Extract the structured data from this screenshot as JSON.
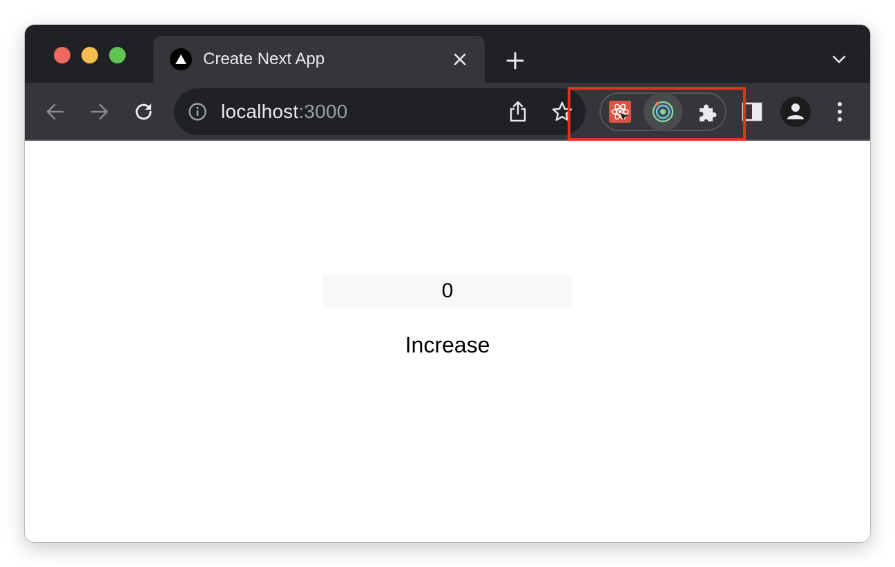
{
  "tab": {
    "title": "Create Next App",
    "favicon": "nextjs-triangle-icon"
  },
  "address_bar": {
    "host": "localhost",
    "port": ":3000"
  },
  "extensions": [
    {
      "name": "react-devtools-icon"
    },
    {
      "name": "radar-extension-icon"
    },
    {
      "name": "extensions-puzzle-icon"
    }
  ],
  "colors": {
    "tabstrip": "#202124",
    "toolbar": "#35363a",
    "omnibox": "#202124",
    "highlight": "#e0331f",
    "traffic_red": "#ee6a5f",
    "traffic_yellow": "#f5bd4f",
    "traffic_green": "#61c454"
  },
  "page": {
    "counter_value": "0",
    "increase_label": "Increase"
  }
}
